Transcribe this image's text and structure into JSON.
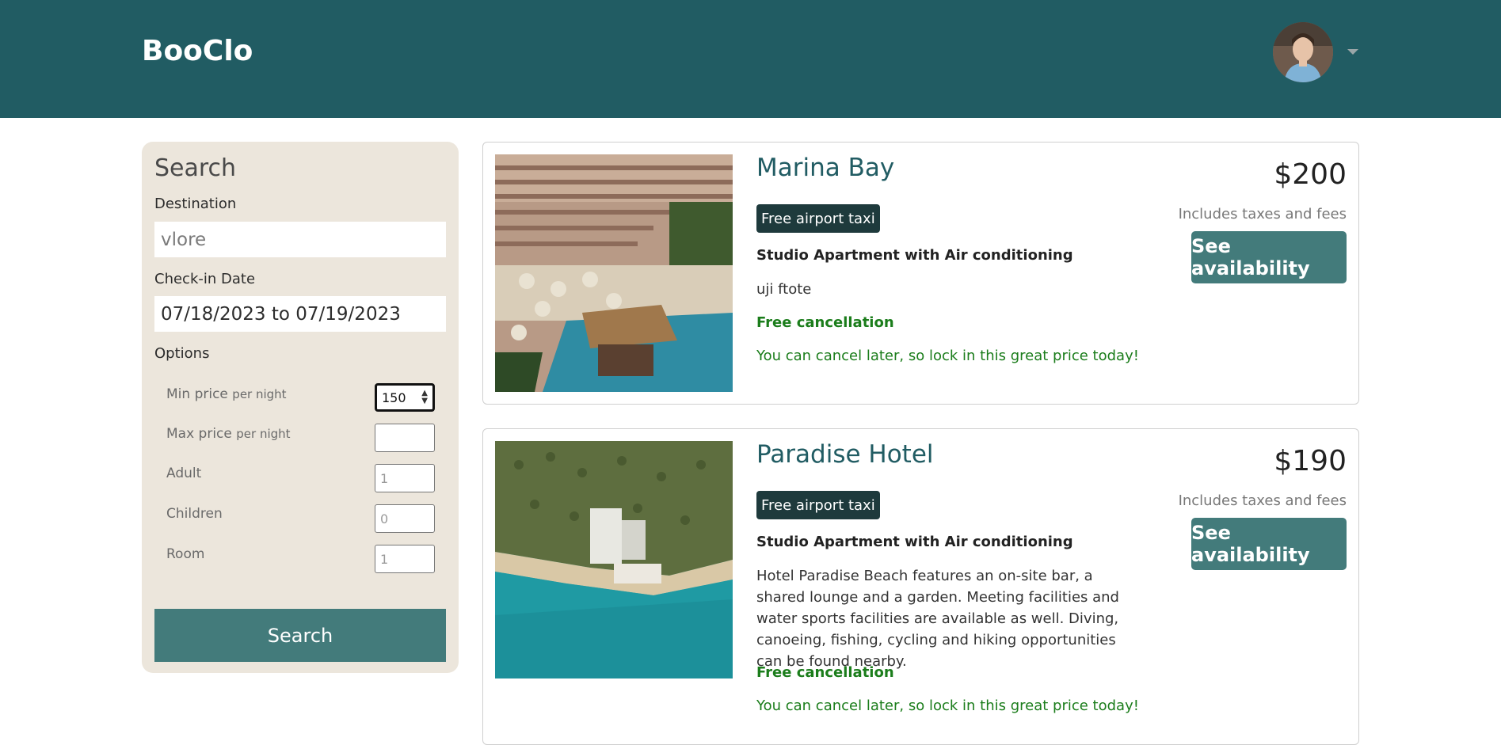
{
  "header": {
    "brand": "BooClo"
  },
  "search": {
    "title": "Search",
    "destination_label": "Destination",
    "destination_value": "vlore",
    "checkin_label": "Check-in Date",
    "checkin_value": "07/18/2023 to 07/19/2023",
    "options_label": "Options",
    "options": {
      "min_price_label": "Min price",
      "min_price_suffix": "per night",
      "min_price_value": "150",
      "max_price_label": "Max price",
      "max_price_suffix": "per night",
      "max_price_value": "",
      "adult_label": "Adult",
      "adult_placeholder": "1",
      "children_label": "Children",
      "children_placeholder": "0",
      "room_label": "Room",
      "room_placeholder": "1"
    },
    "search_button": "Search"
  },
  "results": [
    {
      "name": "Marina Bay",
      "badge": "Free airport taxi",
      "room_type": "Studio Apartment with Air conditioning",
      "description": "uji ftote",
      "free_cancellation": "Free cancellation",
      "cancel_note": "You can cancel later, so lock in this great price today!",
      "price": "$200",
      "taxes_note": "Includes taxes and fees",
      "button": "See availability"
    },
    {
      "name": "Paradise Hotel",
      "badge": "Free airport taxi",
      "room_type": "Studio Apartment with Air conditioning",
      "description": "Hotel Paradise Beach features an on-site bar, a shared lounge and a garden. Meeting facilities and water sports facilities are available as well. Diving, canoeing, fishing, cycling and hiking opportunities can be found nearby.",
      "free_cancellation": "Free cancellation",
      "cancel_note": "You can cancel later, so lock in this great price today!",
      "price": "$190",
      "taxes_note": "Includes taxes and fees",
      "button": "See availability"
    }
  ],
  "colors": {
    "header_bg": "#215c63",
    "panel_bg": "#ece6dc",
    "button_bg": "#437b7b",
    "badge_bg": "#1e3a3c",
    "success": "#1b7d1b"
  }
}
